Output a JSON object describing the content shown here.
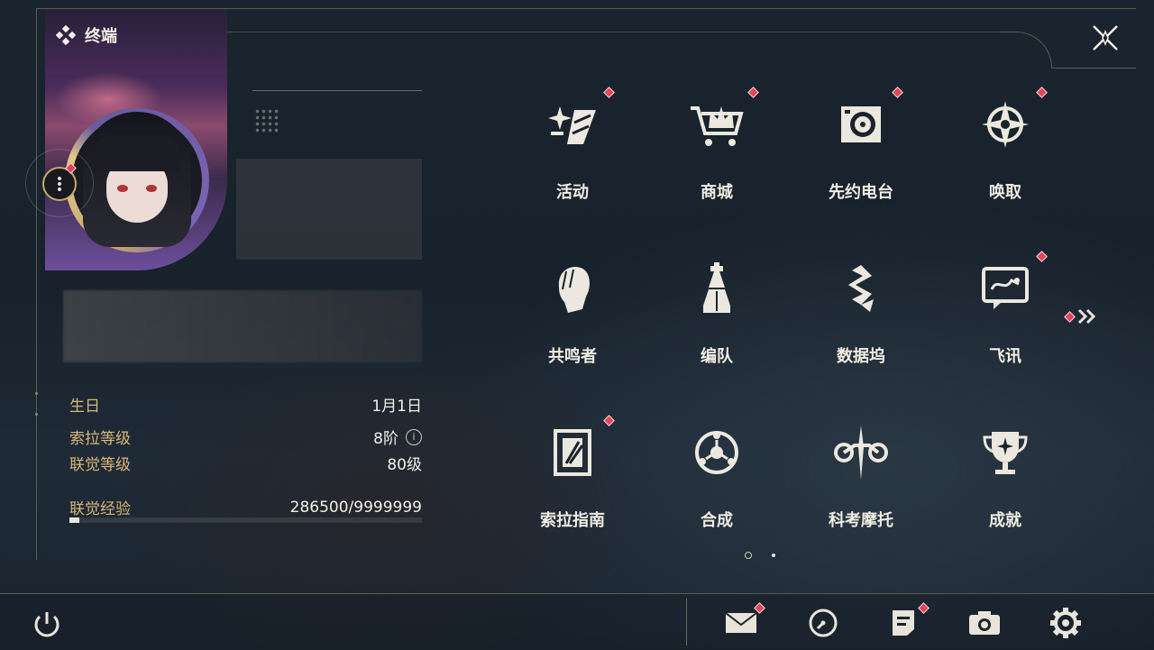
{
  "header": {
    "title": "终端"
  },
  "profile": {
    "stats": [
      {
        "label": "生日",
        "value": "1月1日"
      },
      {
        "label": "索拉等级",
        "value": "8阶"
      },
      {
        "label": "联觉等级",
        "value": "80级"
      },
      {
        "label": "联觉经验",
        "value": "286500/9999999"
      }
    ],
    "exp_progress": 0.0287
  },
  "menu": {
    "items": [
      {
        "label": "活动",
        "icon": "sparkle-icon",
        "badge": true
      },
      {
        "label": "商城",
        "icon": "shop-cart-icon",
        "badge": true
      },
      {
        "label": "先约电台",
        "icon": "radio-icon",
        "badge": true
      },
      {
        "label": "唤取",
        "icon": "compass-star-icon",
        "badge": true
      },
      {
        "label": "共鸣者",
        "icon": "character-head-icon",
        "badge": false
      },
      {
        "label": "编队",
        "icon": "chess-pieces-icon",
        "badge": false
      },
      {
        "label": "数据坞",
        "icon": "data-dock-icon",
        "badge": false
      },
      {
        "label": "飞讯",
        "icon": "message-icon",
        "badge": true
      },
      {
        "label": "索拉指南",
        "icon": "guide-book-icon",
        "badge": true
      },
      {
        "label": "合成",
        "icon": "synthesis-icon",
        "badge": false
      },
      {
        "label": "科考摩托",
        "icon": "motorbike-icon",
        "badge": false
      },
      {
        "label": "成就",
        "icon": "trophy-icon",
        "badge": false
      }
    ]
  },
  "bottom": {
    "icons": [
      "mail-icon",
      "clock-icon",
      "notice-icon",
      "camera-icon",
      "settings-icon"
    ]
  },
  "colors": {
    "accent_gold": "#d9b777",
    "badge_red": "#e0455a",
    "text": "#f1ede4"
  }
}
